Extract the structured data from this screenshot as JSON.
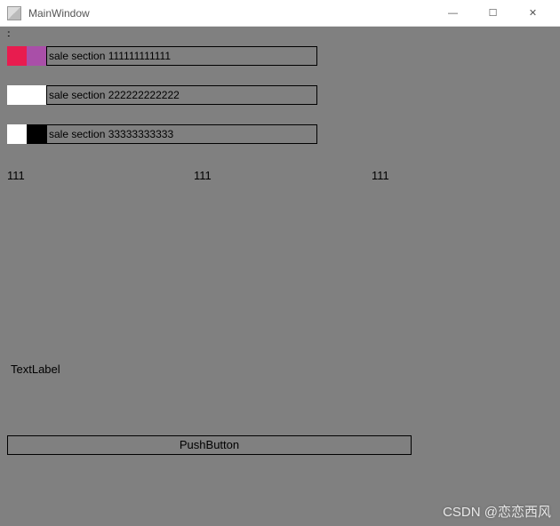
{
  "window": {
    "title": "MainWindow",
    "controls": {
      "min": "—",
      "max": "☐",
      "close": "✕"
    }
  },
  "list": {
    "items": [
      {
        "swatch1": "#E81C4F",
        "swatch2": "#A94FA8",
        "text": "sale section 111111111111"
      },
      {
        "swatch1": "#FFFFFF",
        "swatch2": "#FFFFFF",
        "text": "sale section 222222222222"
      },
      {
        "swatch1": "#FFFFFF",
        "swatch2": "#000000",
        "text": "sale section 33333333333"
      }
    ]
  },
  "labels": {
    "a": "111",
    "b": "111",
    "c": "111"
  },
  "textlabel": "TextLabel",
  "button": {
    "label": "PushButton"
  },
  "watermark": "CSDN @恋恋西风"
}
